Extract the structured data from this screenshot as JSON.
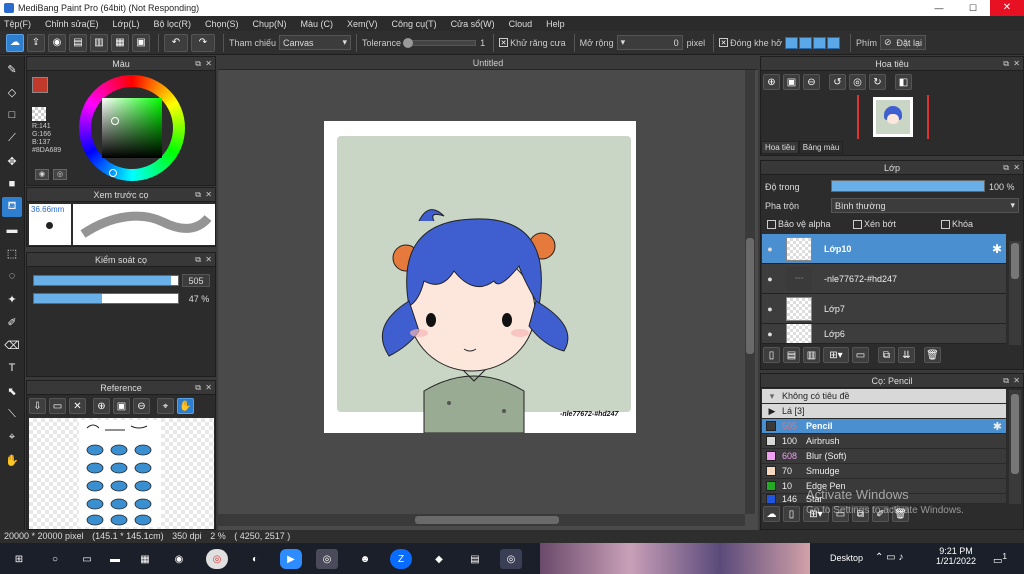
{
  "window": {
    "title": "MediBang Paint Pro (64bit) (Not Responding)",
    "controls": {
      "minimize": "—",
      "maximize": "☐",
      "close": "✕"
    }
  },
  "menu": [
    "Tệp(F)",
    "Chỉnh sửa(E)",
    "Lớp(L)",
    "Bộ lọc(R)",
    "Chọn(S)",
    "Chụp(N)",
    "Màu (C)",
    "Xem(V)",
    "Công cụ(T)",
    "Cửa sổ(W)",
    "Cloud",
    "Help"
  ],
  "toolbar": {
    "reference_label": "Tham chiếu",
    "reference_value": "Canvas",
    "tolerance_label": "Tolerance",
    "tolerance_value": "1",
    "antialias_label": "Khử răng cưa",
    "expand_label": "Mở rộng",
    "expand_value": "0",
    "expand_unit": "pixel",
    "close_gap_label": "Đóng khe hở",
    "shortcut_label": "Phím",
    "reset_label": "Đặt lại"
  },
  "color_panel": {
    "title": "Màu",
    "r": "R:141",
    "g": "G:166",
    "b": "B:137",
    "hex": "#8DA689",
    "fg_color": "#c0392b",
    "bg_color": "#ffffff"
  },
  "brush_preview": {
    "title": "Xem trước cọ",
    "size": "36.66mm"
  },
  "brush_control": {
    "title": "Kiểm soát cọ",
    "size_value": "505",
    "size_fill": 0.95,
    "opacity_value": "47 %",
    "opacity_fill": 0.47
  },
  "reference_panel": {
    "title": "Reference"
  },
  "document": {
    "tab": "Untitled",
    "artist_tag": "-nle77672-#hd247",
    "bg_color": "#c9d6c5"
  },
  "navigator": {
    "title": "Hoa tiêu",
    "tabs": [
      "Hoa tiêu",
      "Bảng màu"
    ]
  },
  "layers": {
    "title": "Lớp",
    "opacity_label": "Độ trong",
    "opacity_value": "100 %",
    "opacity_fill": 1.0,
    "blend_label": "Pha trộn",
    "blend_value": "Bình thường",
    "protect_alpha": "Bảo vệ alpha",
    "clipping": "Xén bớt",
    "lock": "Khóa",
    "items": [
      {
        "name": "Lớp10",
        "selected": true
      },
      {
        "name": "-nle77672-#hd247",
        "selected": false
      },
      {
        "name": "Lớp7",
        "selected": false
      },
      {
        "name": "Lớp6",
        "selected": false
      }
    ]
  },
  "brushes": {
    "title": "Cọ: Pencil",
    "group": "Không có tiêu đề",
    "subgroup": "Lá [3]",
    "items": [
      {
        "size": "505",
        "name": "Pencil",
        "color": "#3a3a3a",
        "selected": true
      },
      {
        "size": "100",
        "name": "Airbrush",
        "color": "#d8d8d8",
        "selected": false
      },
      {
        "size": "608",
        "name": "Blur (Soft)",
        "color": "#f0a0f0",
        "selected": false
      },
      {
        "size": "70",
        "name": "Smudge",
        "color": "#f5d9c0",
        "selected": false
      },
      {
        "size": "10",
        "name": "Edge Pen",
        "color": "#22aa22",
        "selected": false
      },
      {
        "size": "146",
        "name": "Star",
        "color": "#2255dd",
        "selected": false
      }
    ]
  },
  "watermark": {
    "line1": "Activate Windows",
    "line2": "Go to Settings to activate Windows."
  },
  "status": {
    "canvas_size": "20000 * 20000 pixel",
    "physical_size": "(145.1 * 145.1cm)",
    "dpi": "350 dpi",
    "zoom": "2 %",
    "cursor": "( 4250, 2517 )"
  },
  "taskbar": {
    "desktop_label": "Desktop",
    "time": "9:21 PM",
    "date": "1/21/2022",
    "notification_count": "1"
  }
}
